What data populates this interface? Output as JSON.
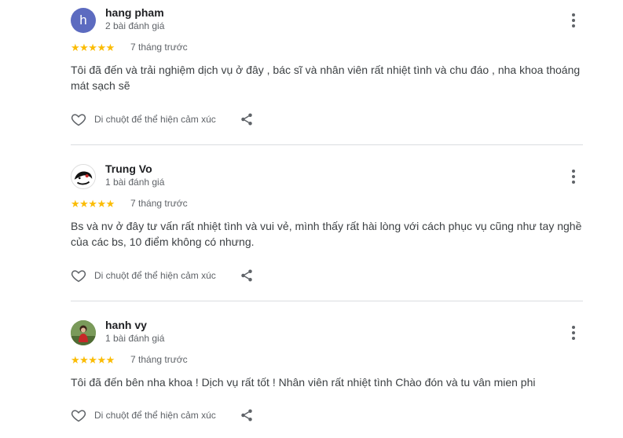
{
  "reviews": [
    {
      "avatar_letter": "h",
      "name": "hang pham",
      "review_count": "2 bài đánh giá",
      "stars": "★★★★★",
      "rating": 5,
      "time": "7 tháng trước",
      "text": "Tôi đã đến và trải nghiệm dịch vụ ở đây , bác sĩ và nhân viên rất nhiệt tình và chu đáo , nha khoa thoáng mát sạch sẽ",
      "react_label": "Di chuột để thể hiện cảm xúc"
    },
    {
      "name": "Trung Vo",
      "review_count": "1 bài đánh giá",
      "stars": "★★★★★",
      "rating": 5,
      "time": "7 tháng trước",
      "text": "Bs và nv ở đây tư vấn rất nhiệt tình và vui vẻ, mình thấy rất hài lòng với cách phục vụ cũng như tay nghề của các bs, 10 điểm không có nhưng.",
      "react_label": "Di chuột để thể hiện cảm xúc"
    },
    {
      "name": "hanh vy",
      "review_count": "1 bài đánh giá",
      "stars": "★★★★★",
      "rating": 5,
      "time": "7 tháng trước",
      "text": "Tôi đã đến bên nha khoa ! Dịch vụ rất tốt ! Nhân viên rất nhiệt tình Chào đón và tu vân mien phi",
      "react_label": "Di chuột để thể hiện cảm xúc"
    }
  ],
  "colors": {
    "star": "#fbbc04",
    "avatar_letter_bg": "#5c6bc0",
    "divider": "#dadce0"
  }
}
